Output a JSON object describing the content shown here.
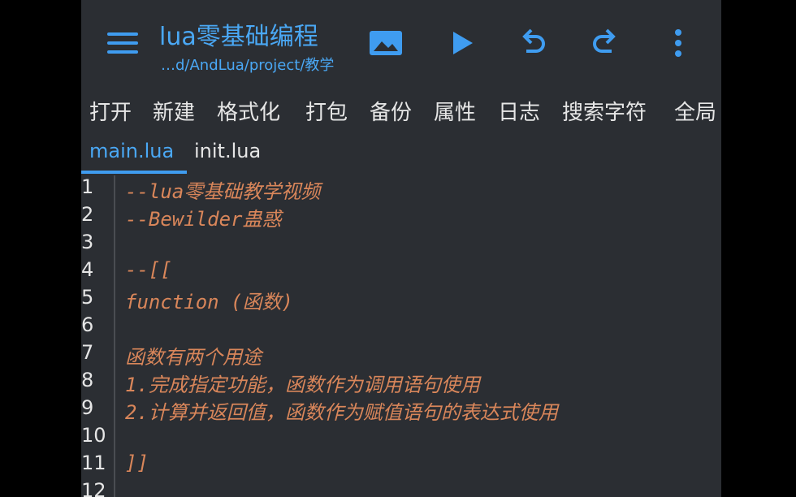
{
  "app": {
    "title": "lua零基础编程",
    "path": "…d/AndLua/project/教学"
  },
  "toolbar": {
    "actions": [
      {
        "name": "image-icon"
      },
      {
        "name": "play-icon"
      },
      {
        "name": "undo-icon"
      },
      {
        "name": "redo-icon"
      },
      {
        "name": "more-vert-icon"
      }
    ]
  },
  "menu": {
    "items": [
      "打开",
      "新建",
      "格式化",
      "打包",
      "备份",
      "属性",
      "日志",
      "搜索字符",
      "全局"
    ]
  },
  "tabs": [
    {
      "label": "main.lua",
      "active": true
    },
    {
      "label": "init.lua",
      "active": false
    }
  ],
  "editor": {
    "lines": [
      {
        "num": "1",
        "text": "--lua零基础教学视频"
      },
      {
        "num": "2",
        "text": "--Bewilder蛊惑"
      },
      {
        "num": "3",
        "text": ""
      },
      {
        "num": "4",
        "text": "--[["
      },
      {
        "num": "5",
        "text": "function (函数)"
      },
      {
        "num": "6",
        "text": ""
      },
      {
        "num": "7",
        "text": "函数有两个用途"
      },
      {
        "num": "8",
        "text": "1.完成指定功能，函数作为调用语句使用"
      },
      {
        "num": "9",
        "text": "2.计算并返回值，函数作为赋值语句的表达式使用"
      },
      {
        "num": "10",
        "text": ""
      },
      {
        "num": "11",
        "text": "]]"
      },
      {
        "num": "12",
        "text": ""
      }
    ]
  },
  "colors": {
    "accent": "#4aa8f5",
    "background": "#2b2e33",
    "comment": "#d9865a",
    "text": "#e6e6e6"
  }
}
